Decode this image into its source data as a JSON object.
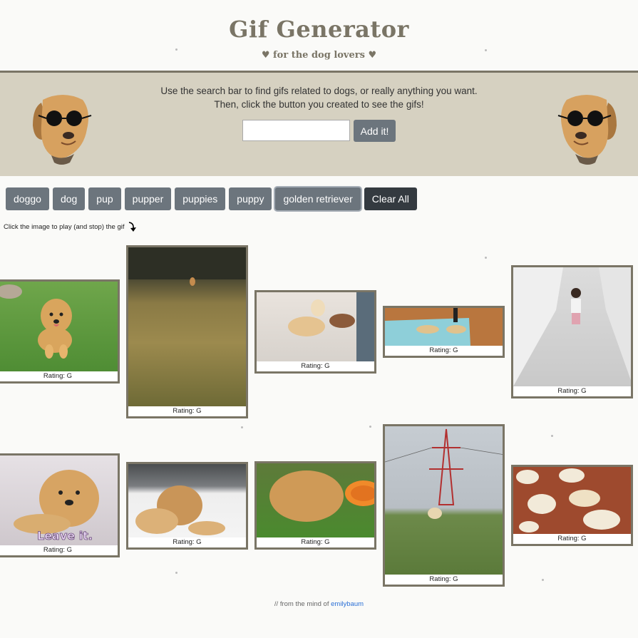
{
  "header": {
    "title": "Gif Generator",
    "subtitle": "♥ for the dog lovers ♥"
  },
  "intro": {
    "line1": "Use the search bar to find gifs related to dogs, or really anything you want.",
    "line2": "Then, click the button you created to see the gifs!",
    "search_value": "",
    "add_label": "Add it!"
  },
  "buttons": [
    "doggo",
    "dog",
    "pup",
    "pupper",
    "puppies",
    "puppy",
    "golden retriever"
  ],
  "clear_label": "Clear All",
  "instruction": "Click the image to play (and stop) the gif",
  "gifs": [
    {
      "rating": "Rating: G",
      "subject": "golden-retriever-on-grass"
    },
    {
      "rating": "Rating: G",
      "subject": "dog-in-field"
    },
    {
      "rating": "Rating: G",
      "subject": "puppy-with-toy"
    },
    {
      "rating": "Rating: G",
      "subject": "dogs-in-pool"
    },
    {
      "rating": "Rating: G",
      "subject": "toddler-in-hallway"
    },
    {
      "rating": "Rating: G",
      "subject": "puppy-leave-it",
      "caption": "Leave it."
    },
    {
      "rating": "Rating: G",
      "subject": "dogs-in-snow"
    },
    {
      "rating": "Rating: G",
      "subject": "puppy-with-frisbee"
    },
    {
      "rating": "Rating: G",
      "subject": "dog-under-power-tower"
    },
    {
      "rating": "Rating: G",
      "subject": "puppies-with-baby"
    }
  ],
  "footer": {
    "prefix": "// from the mind of",
    "author": "emilybaum"
  },
  "colors": {
    "band": "#d6d1c1",
    "border": "#7a7566",
    "button": "#6c757d",
    "button_dark": "#343a40",
    "link": "#2a6fd6"
  }
}
